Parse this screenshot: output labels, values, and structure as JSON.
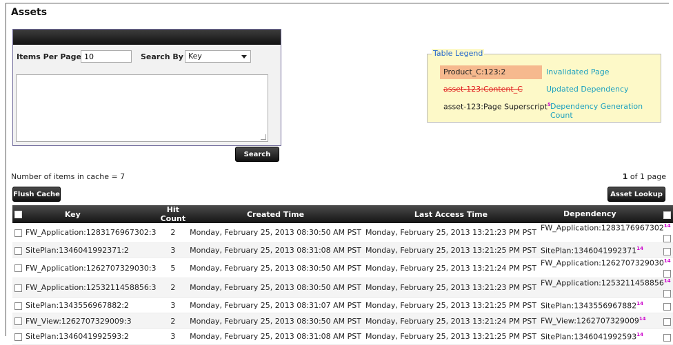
{
  "page": {
    "title": "Assets"
  },
  "search": {
    "items_per_page_label": "Items Per Page",
    "items_per_page_value": "10",
    "search_by_label": "Search By",
    "search_by_value": "Key",
    "search_button": "Search"
  },
  "legend": {
    "title": "Table Legend",
    "rows": [
      {
        "key": "Product_C:123:2",
        "desc": "Invalidated Page"
      },
      {
        "key": "asset-123:Content_C",
        "desc": "Updated Dependency"
      },
      {
        "key": "asset-123:Page Superscript",
        "sup": "5",
        "desc": "Dependency Generation Count"
      }
    ]
  },
  "cache": {
    "count_text": "Number of items in cache = 7",
    "page_current": "1",
    "page_suffix": "of 1 page",
    "flush_button": "Flush Cache",
    "lookup_button": "Asset Lookup"
  },
  "table": {
    "columns": [
      "Key",
      "Hit Count",
      "Created Time",
      "Last Access Time",
      "Dependency"
    ],
    "rows": [
      {
        "key": "FW_Application:1283176967302:3",
        "hits": "2",
        "created": "Monday, February 25, 2013 08:30:50 AM PST",
        "accessed": "Monday, February 25, 2013 13:21:23 PM PST",
        "dep": "FW_Application:1283176967302",
        "gen": "14"
      },
      {
        "key": "SitePlan:1346041992371:2",
        "hits": "3",
        "created": "Monday, February 25, 2013 08:31:08 AM PST",
        "accessed": "Monday, February 25, 2013 13:21:25 PM PST",
        "dep": "SitePlan:1346041992371",
        "gen": "14"
      },
      {
        "key": "FW_Application:1262707329030:3",
        "hits": "5",
        "created": "Monday, February 25, 2013 08:30:50 AM PST",
        "accessed": "Monday, February 25, 2013 13:21:24 PM PST",
        "dep": "FW_Application:1262707329030",
        "gen": "14"
      },
      {
        "key": "FW_Application:1253211458856:3",
        "hits": "2",
        "created": "Monday, February 25, 2013 08:30:50 AM PST",
        "accessed": "Monday, February 25, 2013 13:21:23 PM PST",
        "dep": "FW_Application:1253211458856",
        "gen": "14"
      },
      {
        "key": "SitePlan:1343556967882:2",
        "hits": "3",
        "created": "Monday, February 25, 2013 08:31:07 AM PST",
        "accessed": "Monday, February 25, 2013 13:21:25 PM PST",
        "dep": "SitePlan:1343556967882",
        "gen": "14"
      },
      {
        "key": "FW_View:1262707329009:3",
        "hits": "2",
        "created": "Monday, February 25, 2013 08:30:50 AM PST",
        "accessed": "Monday, February 25, 2013 13:21:24 PM PST",
        "dep": "FW_View:1262707329009",
        "gen": "14"
      },
      {
        "key": "SitePlan:1346041992593:2",
        "hits": "3",
        "created": "Monday, February 25, 2013 08:31:08 AM PST",
        "accessed": "Monday, February 25, 2013 13:21:25 PM PST",
        "dep": "SitePlan:1346041992593",
        "gen": "14"
      }
    ]
  }
}
